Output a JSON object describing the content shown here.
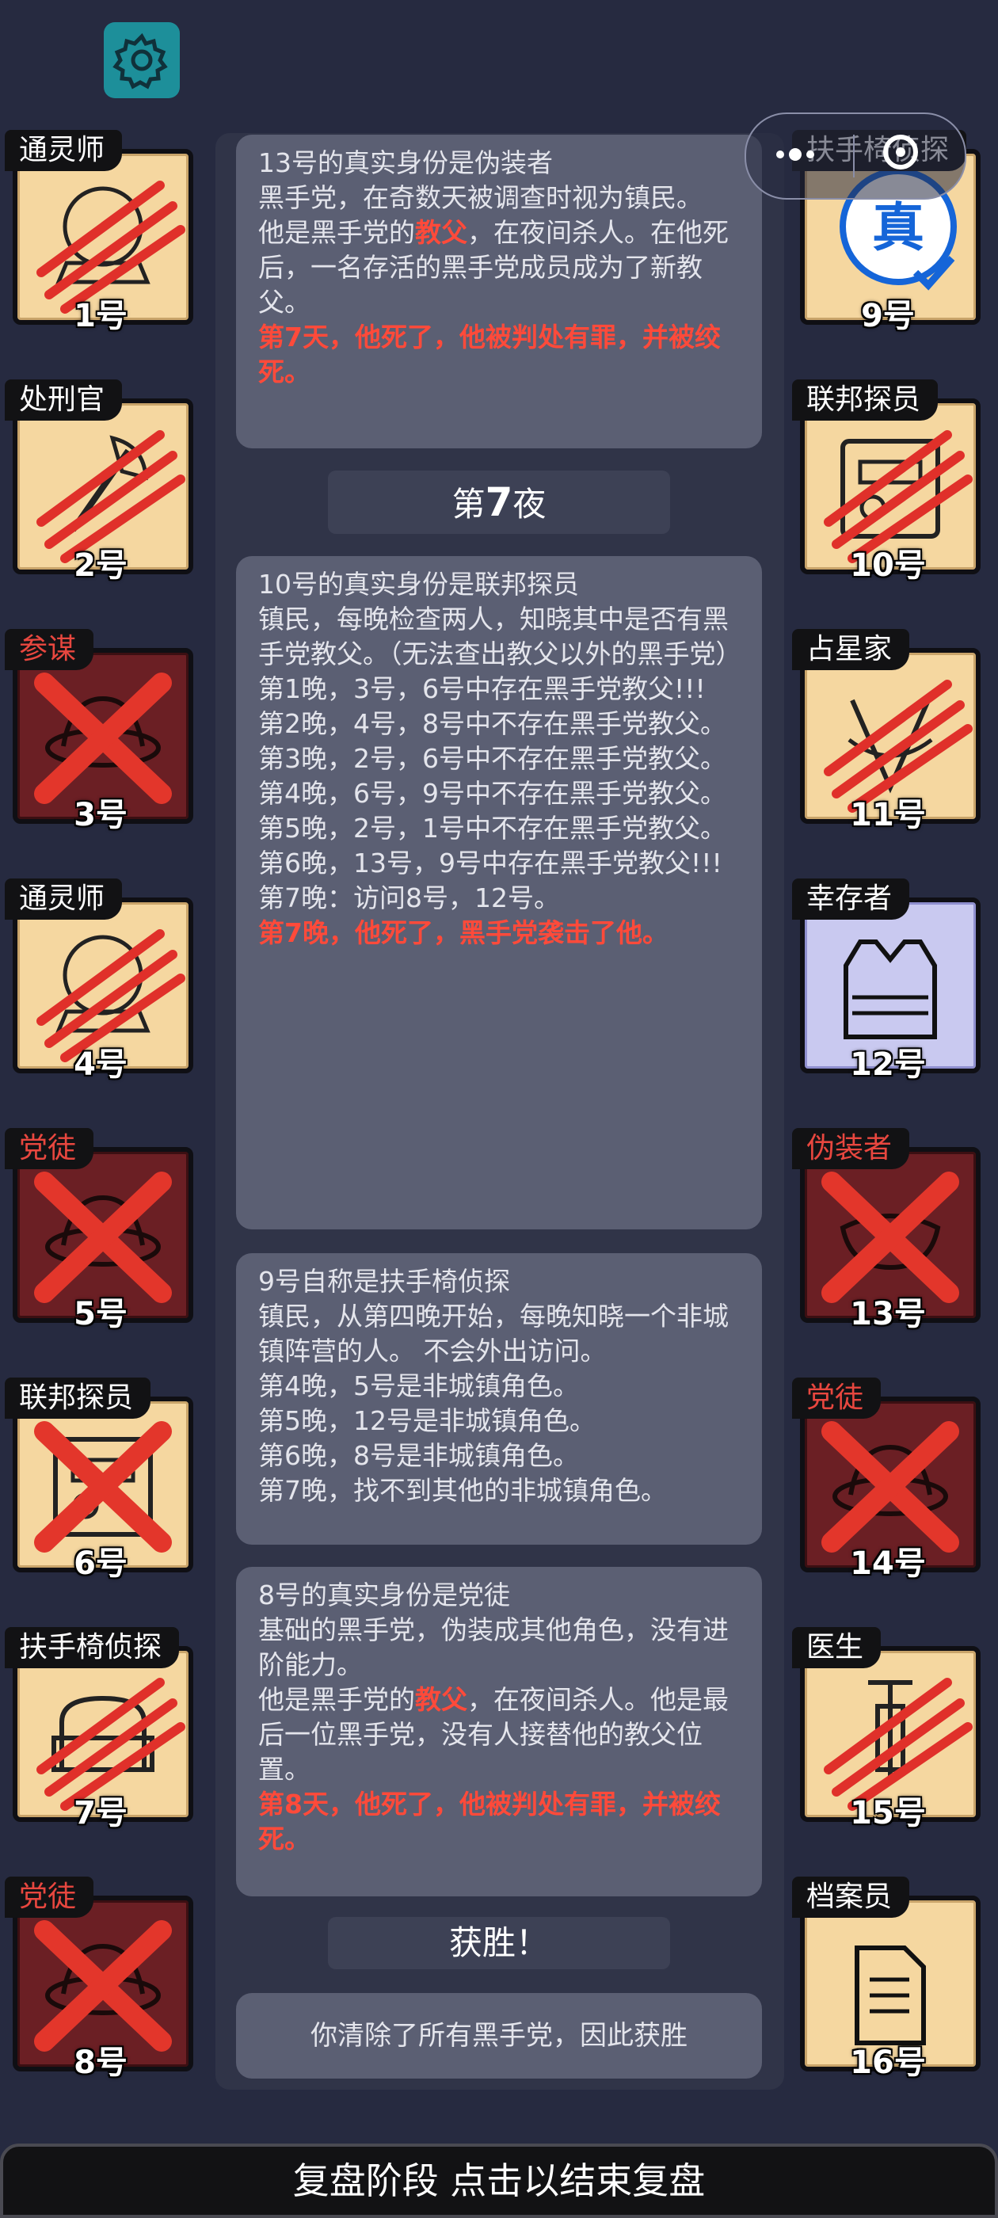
{
  "settings_icon": "gear-icon",
  "capsule": {
    "more_icon": "more-dots-icon",
    "close_icon": "close-circle-icon"
  },
  "left_players": [
    {
      "role": "通灵师",
      "num": "1号",
      "status": "clawed",
      "icon": "crystal-ball-icon"
    },
    {
      "role": "处刑官",
      "num": "2号",
      "status": "clawed",
      "icon": "axe-icon"
    },
    {
      "role": "参谋",
      "num": "3号",
      "status": "dead",
      "icon": "mafia-icon"
    },
    {
      "role": "通灵师",
      "num": "4号",
      "status": "clawed",
      "icon": "crystal-ball-icon"
    },
    {
      "role": "党徒",
      "num": "5号",
      "status": "dead",
      "icon": "mafia-icon"
    },
    {
      "role": "联邦探员",
      "num": "6号",
      "status": "dead-light",
      "icon": "badge-icon"
    },
    {
      "role": "扶手椅侦探",
      "num": "7号",
      "status": "clawed",
      "icon": "armchair-icon"
    },
    {
      "role": "党徒",
      "num": "8号",
      "status": "dead",
      "icon": "mafia-icon"
    }
  ],
  "right_players": [
    {
      "role": "扶手椅侦探",
      "num": "9号",
      "status": "verified",
      "icon": "verified-badge-icon",
      "badge": "真"
    },
    {
      "role": "联邦探员",
      "num": "10号",
      "status": "clawed",
      "icon": "badge-icon"
    },
    {
      "role": "占星家",
      "num": "11号",
      "status": "clawed",
      "icon": "sextant-icon"
    },
    {
      "role": "幸存者",
      "num": "12号",
      "status": "survivor",
      "icon": "vest-icon"
    },
    {
      "role": "伪装者",
      "num": "13号",
      "status": "dead",
      "icon": "mask-icon"
    },
    {
      "role": "党徒",
      "num": "14号",
      "status": "dead",
      "icon": "mafia-icon"
    },
    {
      "role": "医生",
      "num": "15号",
      "status": "clawed",
      "icon": "syringe-icon"
    },
    {
      "role": "档案员",
      "num": "16号",
      "status": "alive",
      "icon": "files-icon"
    }
  ],
  "box1": {
    "lines": [
      "13号的真实身份是伪装者",
      "黑手党，在奇数天被调查时视为镇民。"
    ],
    "line3_a": "他是黑手党的",
    "line3_kw": "教父",
    "line3_b": "，在夜间杀人。在他死后，一名存活的黑手党成员成为了新教父。",
    "red": "第7天，他死了，他被判处有罪，并被绞死。"
  },
  "night7": {
    "prefix": "第",
    "num": "7",
    "suffix": "夜"
  },
  "box2": {
    "lines": [
      "10号的真实身份是联邦探员",
      "镇民，每晚检查两人，知晓其中是否有黑手党教父。（无法查出教父以外的黑手党）",
      "第1晚，3号，6号中存在黑手党教父!!!",
      "第2晚，4号，8号中不存在黑手党教父。",
      "第3晚，2号，6号中不存在黑手党教父。",
      "第4晚，6号，9号中不存在黑手党教父。",
      "第5晚，2号，1号中不存在黑手党教父。",
      "第6晚，13号，9号中存在黑手党教父!!!",
      "第7晚：访问8号，12号。"
    ],
    "red": "第7晚，他死了，黑手党袭击了他。"
  },
  "box3": {
    "lines": [
      "9号自称是扶手椅侦探",
      "镇民，从第四晚开始，每晚知晓一个非城镇阵营的人。 不会外出访问。",
      "第4晚，5号是非城镇角色。",
      "第5晚，12号是非城镇角色。",
      "第6晚，8号是非城镇角色。",
      "第7晚，找不到其他的非城镇角色。"
    ]
  },
  "box4": {
    "lines": [
      "8号的真实身份是党徒",
      "基础的黑手党，伪装成其他角色，没有进阶能力。"
    ],
    "line3_a": "他是黑手党的",
    "line3_kw": "教父",
    "line3_b": "，在夜间杀人。他是最后一位黑手党，没有人接替他的教父位置。",
    "red": "第8天，他死了，他被判处有罪，并被绞死。"
  },
  "victory": "获胜！",
  "result": "你清除了所有黑手党，因此获胜",
  "bottom_bar": "复盘阶段 点击以结束复盘",
  "colors": {
    "background": "#262a40",
    "panel": "#303448",
    "box": "#5b5f73",
    "alert_red": "#ff4a3a",
    "card_tan": "#f5d7a0",
    "dead_red": "#6b1f24",
    "settings_teal": "#1d8f9a"
  }
}
